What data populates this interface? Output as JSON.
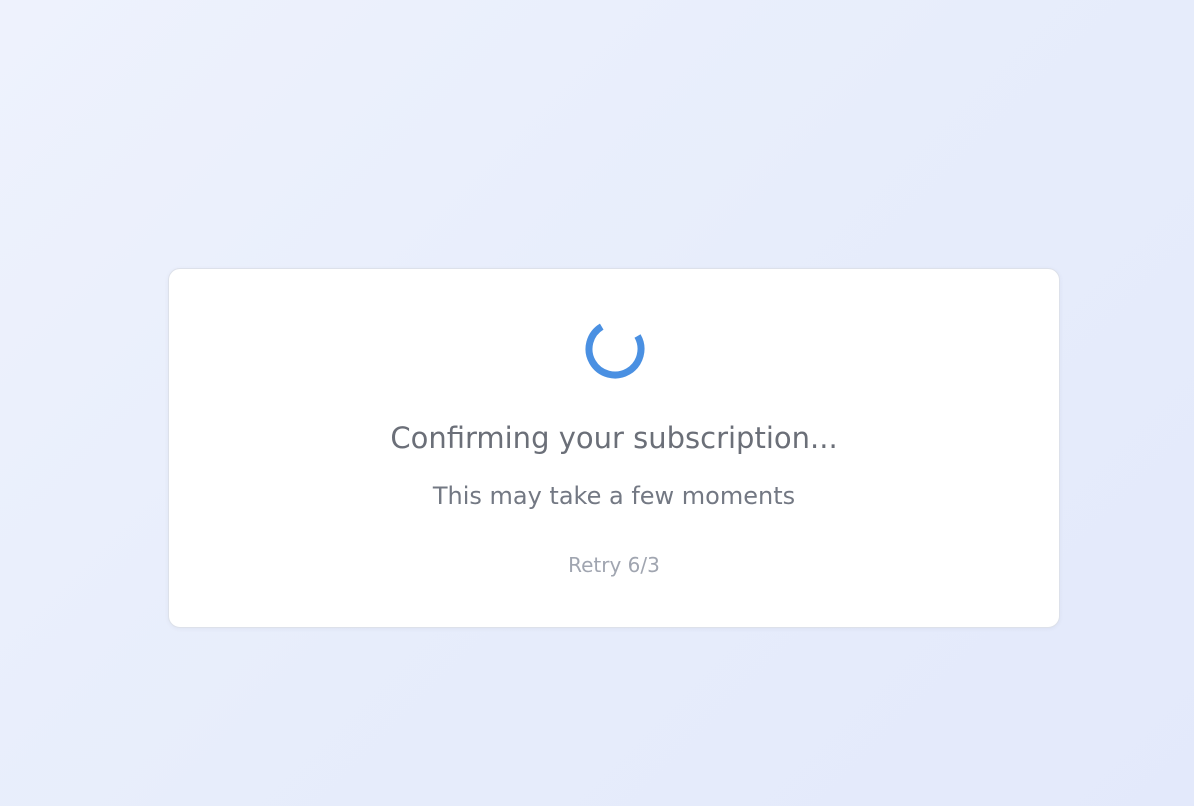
{
  "status": {
    "title": "Confirming your subscription...",
    "subtitle": "This may take a few moments",
    "retry_text": "Retry 6/3"
  },
  "spinner": {
    "icon": "loading-spinner-icon",
    "color": "#4a90e2"
  }
}
